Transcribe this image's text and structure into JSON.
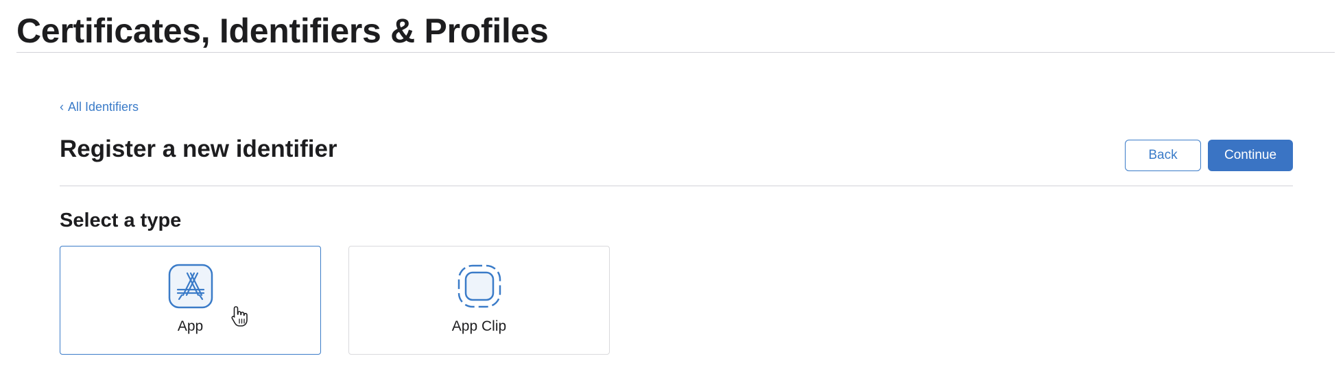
{
  "header": {
    "title": "Certificates, Identifiers & Profiles"
  },
  "breadcrumb": {
    "chevron": "‹",
    "label": "All Identifiers"
  },
  "page": {
    "title": "Register a new identifier",
    "back_button": "Back",
    "continue_button": "Continue"
  },
  "type_selection": {
    "heading": "Select a type",
    "options": [
      {
        "label": "App",
        "icon": "app-store-icon",
        "selected": true
      },
      {
        "label": "App Clip",
        "icon": "app-clip-icon",
        "selected": false
      }
    ]
  },
  "colors": {
    "accent": "#3a7bc8",
    "primary_button": "#3a74c4",
    "divider": "#d2d2d7",
    "text": "#1d1d1f"
  }
}
